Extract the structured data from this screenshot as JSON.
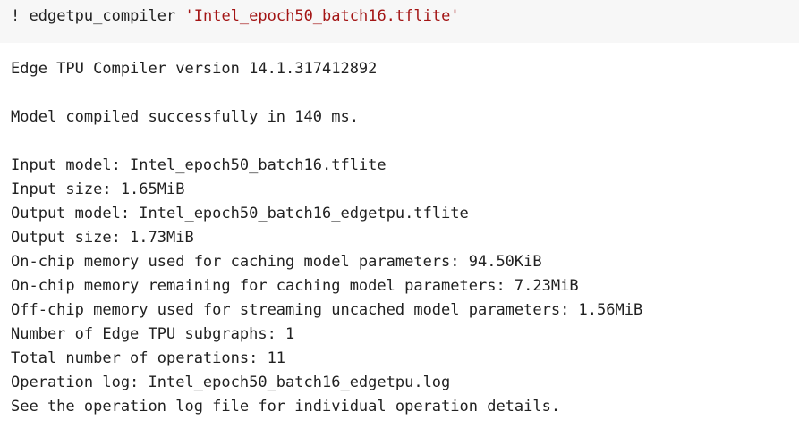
{
  "input_cell": {
    "bang": "!",
    "command": "edgetpu_compiler",
    "argument": "'Intel_epoch50_batch16.tflite'"
  },
  "output": {
    "lines": [
      "Edge TPU Compiler version 14.1.317412892",
      "",
      "Model compiled successfully in 140 ms.",
      "",
      "Input model: Intel_epoch50_batch16.tflite",
      "Input size: 1.65MiB",
      "Output model: Intel_epoch50_batch16_edgetpu.tflite",
      "Output size: 1.73MiB",
      "On-chip memory used for caching model parameters: 94.50KiB",
      "On-chip memory remaining for caching model parameters: 7.23MiB",
      "Off-chip memory used for streaming uncached model parameters: 1.56MiB",
      "Number of Edge TPU subgraphs: 1",
      "Total number of operations: 11",
      "Operation log: Intel_epoch50_batch16_edgetpu.log",
      "See the operation log file for individual operation details."
    ]
  },
  "colors": {
    "cell_background": "#f7f7f7",
    "text": "#212121",
    "string_literal": "#a31515"
  }
}
